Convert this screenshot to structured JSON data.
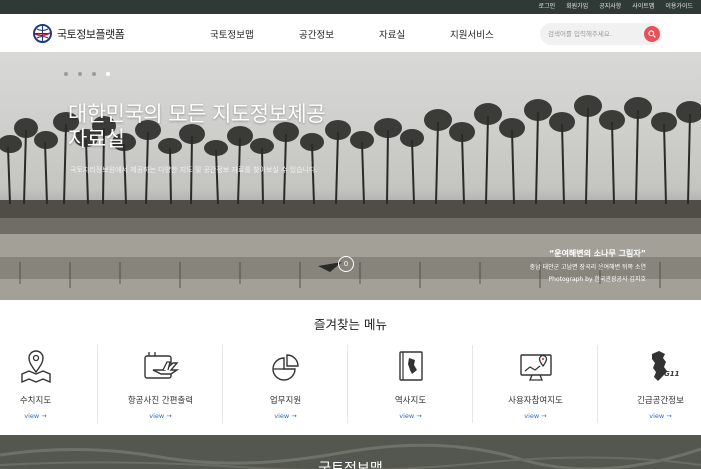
{
  "utility_nav": [
    "로그인",
    "회원가입",
    "공지사항",
    "사이트맵",
    "이용가이드"
  ],
  "brand": {
    "name": "국토정보플랫폼"
  },
  "gnb": [
    "국토정보맵",
    "공간정보",
    "자료실",
    "지원서비스"
  ],
  "search": {
    "placeholder": "검색어를 입력해주세요."
  },
  "hero": {
    "title_line1": "대한민국의 모든 지도정보제공",
    "title_line2": "자료실",
    "subtitle": "국토지리정보원에서 제공하는 다양한 지도 및 공간정보 자료를 찾아보실 수 있습니다.",
    "slide_indicator": {
      "total": 4,
      "active": 4
    },
    "play_label": "0",
    "caption_title": "“운여해변의 소나무 그림자”",
    "caption_line1": "충남 태안군 고남면 장곡리 운여해변 뒤쪽 소연",
    "caption_line2": "Photograph by 한국관광공사 김지호"
  },
  "favorites": {
    "title": "즐겨찾는 메뉴",
    "items": [
      {
        "label": "수치지도",
        "view": "view →",
        "icon": "map-pin-icon"
      },
      {
        "label": "항공사진 간편출력",
        "view": "view →",
        "icon": "airplane-icon"
      },
      {
        "label": "업무지원",
        "view": "view →",
        "icon": "pie-chart-icon"
      },
      {
        "label": "역사지도",
        "view": "view →",
        "icon": "book-map-icon"
      },
      {
        "label": "사용자참여지도",
        "view": "view →",
        "icon": "monitor-map-icon"
      },
      {
        "label": "긴급공간정보",
        "view": "view →",
        "icon": "g119-icon",
        "badge": "G119"
      }
    ]
  },
  "map_section": {
    "title": "국토정보맵"
  },
  "colors": {
    "topbar": "#2f3a36",
    "accent": "#e8505b",
    "link": "#2a6fc6"
  }
}
